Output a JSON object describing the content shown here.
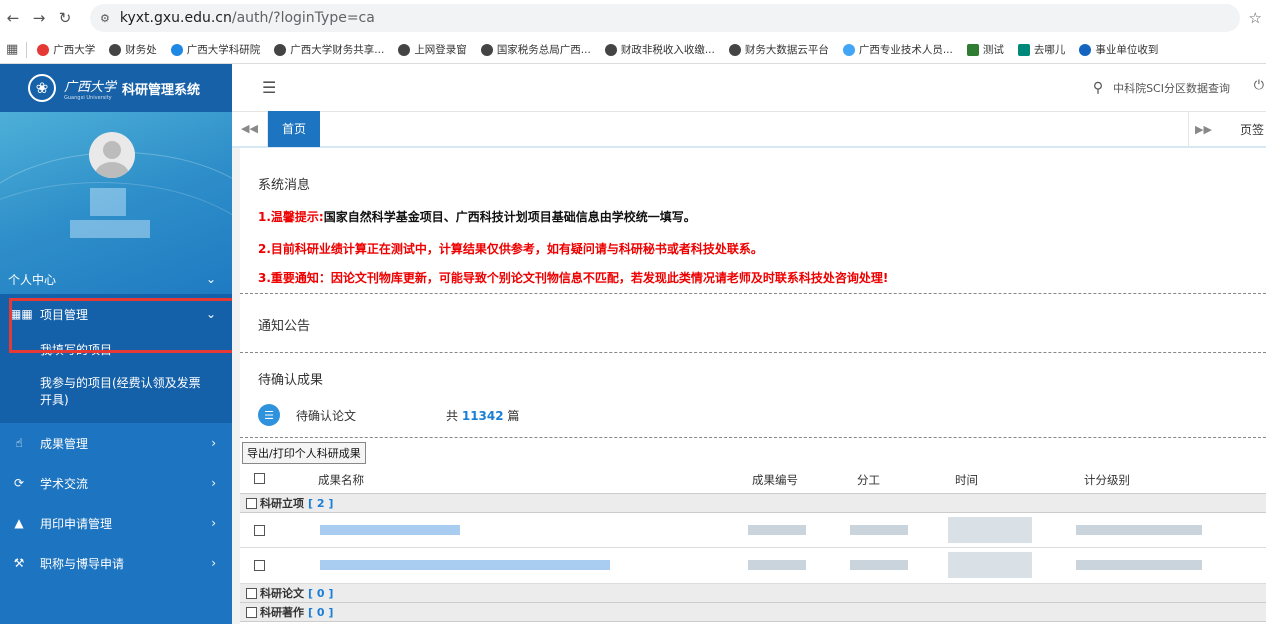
{
  "browser": {
    "url_host": "kyxt.gxu.edu.cn",
    "url_path": "/auth/?loginType=ca",
    "bookmarks": [
      {
        "label": "广西大学",
        "color": "#e53935"
      },
      {
        "label": "财务处",
        "color": "#444444"
      },
      {
        "label": "广西大学科研院",
        "color": "#1e88e5"
      },
      {
        "label": "广西大学财务共享...",
        "color": "#444444"
      },
      {
        "label": "上网登录窗",
        "color": "#444444"
      },
      {
        "label": "国家税务总局广西...",
        "color": "#444444"
      },
      {
        "label": "财政非税收入收缴...",
        "color": "#444444"
      },
      {
        "label": "财务大数据云平台",
        "color": "#444444"
      },
      {
        "label": "广西专业技术人员...",
        "color": "#42a5f5"
      },
      {
        "label": "测试",
        "color": "#2e7d32"
      },
      {
        "label": "去哪儿",
        "color": "#00897b"
      },
      {
        "label": "事业单位收到",
        "color": "#1565c0"
      }
    ]
  },
  "sidebar": {
    "logo_cn": "广西大学",
    "logo_en": "Guangxi University",
    "system_name": "科研管理系统",
    "personal_center": "个人中心",
    "menu": [
      {
        "label": "项目管理",
        "icon": "grid-icon",
        "expanded": true
      },
      {
        "label": "成果管理",
        "icon": "thumbs-up-icon"
      },
      {
        "label": "学术交流",
        "icon": "refresh-icon"
      },
      {
        "label": "用印申请管理",
        "icon": "stamp-icon"
      },
      {
        "label": "职称与博导申请",
        "icon": "hammer-icon"
      }
    ],
    "submenu": [
      "我填写的项目",
      "我参与的项目(经费认领及发票开具)"
    ]
  },
  "header": {
    "search_link": "中科院SCI分区数据查询"
  },
  "tabs": {
    "home": "首页",
    "page_sign": "页签"
  },
  "main": {
    "system_messages_title": "系统消息",
    "notices": [
      {
        "prefix": "1.温馨提示:",
        "text": "国家自然科学基金项目、广西科技计划项目基础信息由学校统一填写。"
      },
      {
        "prefix": "2.",
        "text": "目前科研业绩计算正在测试中，计算结果仅供参考，如有疑问请与科研秘书或者科技处联系。"
      },
      {
        "prefix": "3.",
        "text": "重要通知：因论文刊物库更新，可能导致个别论文刊物信息不匹配，若发现此类情况请老师及时联系科技处咨询处理!"
      }
    ],
    "announcement_title": "通知公告",
    "pending_title": "待确认成果",
    "pending_item": "待确认论文",
    "pending_count_prefix": "共",
    "pending_count": "11342",
    "pending_count_suffix": "篇",
    "export_button": "导出/打印个人科研成果",
    "table_headers": [
      "成果名称",
      "成果编号",
      "分工",
      "时间",
      "计分级别"
    ],
    "groups": [
      {
        "label": "科研立项",
        "count": "[ 2 ]"
      },
      {
        "label": "科研论文",
        "count": "[ 0 ]"
      },
      {
        "label": "科研著作",
        "count": "[ 0 ]"
      }
    ]
  }
}
